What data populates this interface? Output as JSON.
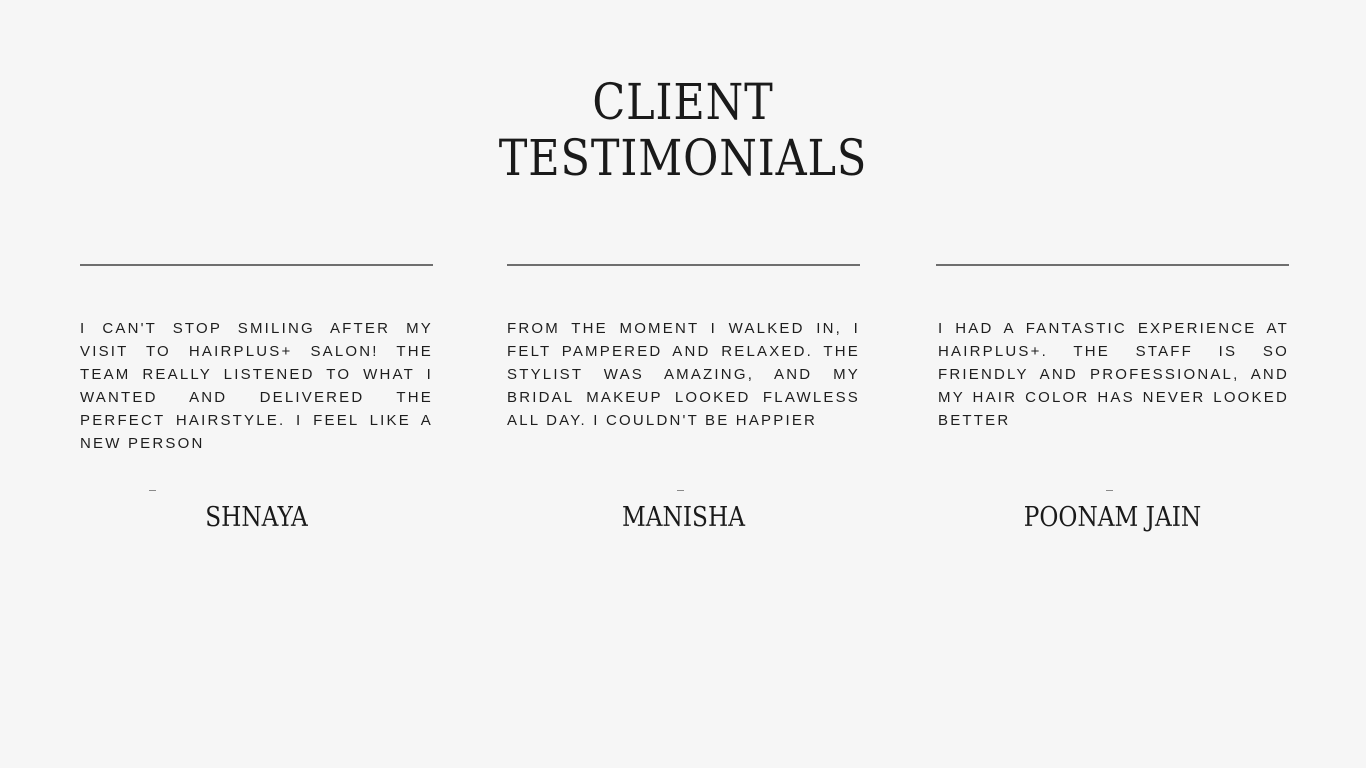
{
  "section": {
    "title_line1": "CLIENT",
    "title_line2": "TESTIMONIALS"
  },
  "testimonials": [
    {
      "quote": "I can't stop smiling after my visit to Hairplus+ Salon! The team really listened to what I wanted and delivered the perfect hairstyle. I feel like a new person",
      "author": "SHNAYA"
    },
    {
      "quote": "From the moment I walked in, I felt pampered and relaxed. The stylist was amazing, and my bridal makeup looked flawless all day. I couldn't be happier",
      "author": "MANISHA"
    },
    {
      "quote": "I had a fantastic experience at Hairplus+. The staff is so friendly and professional, and my hair color has never looked better",
      "author": "POONAM JAIN"
    }
  ]
}
